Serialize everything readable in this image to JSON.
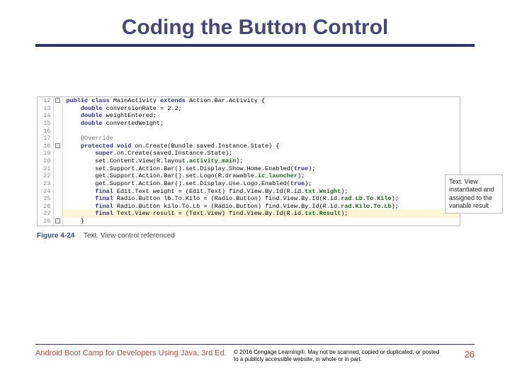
{
  "title": "Coding the Button Control",
  "callout": "Text. View instantiated and assigned to the variable result",
  "caption_fig": "Figure 4-24",
  "caption_text": "Text. View control referenced",
  "footer": {
    "book": "Android Boot Camp for Developers Using Java, 3rd Ed.",
    "copyright": "© 2016 Cengage Learning®. May not be scanned, copied or duplicated, or posted to a publicly accessible website, in whole or in part.",
    "page": "26"
  },
  "code": {
    "lines": [
      {
        "n": "12",
        "fold": "⊟",
        "hl": false,
        "html": "<span class='kw'>public class</span> MainActivity <span class='kw'>extends</span> Action.Bar.Activity {"
      },
      {
        "n": "13",
        "fold": "",
        "hl": false,
        "html": "    <span class='kw'>double</span> conversionRate = 2.2;"
      },
      {
        "n": "14",
        "fold": "",
        "hl": false,
        "html": "    <span class='kw'>double</span> weightEntered;"
      },
      {
        "n": "15",
        "fold": "",
        "hl": false,
        "html": "    <span class='kw'>double</span> convertedWeight;"
      },
      {
        "n": "16",
        "fold": "",
        "hl": false,
        "html": ""
      },
      {
        "n": "17",
        "fold": "",
        "hl": false,
        "html": "    <span class='at'>@Override</span>"
      },
      {
        "n": "18",
        "fold": "⊟",
        "hl": false,
        "html": "    <span class='kw'>protected void</span> on.Create(Bundle saved.Instance.State) {"
      },
      {
        "n": "19",
        "fold": "",
        "hl": false,
        "html": "        <span class='kw'>super</span>.on.Create(saved.Instance.State);"
      },
      {
        "n": "20",
        "fold": "",
        "hl": false,
        "html": "        set.Content.View(R.layout.<span class='st'>activity_main</span>);"
      },
      {
        "n": "21",
        "fold": "",
        "hl": false,
        "html": "        set.Support.Action.Bar().set.Display.Show.Home.Enabled(<span class='kw'>true</span>);"
      },
      {
        "n": "22",
        "fold": "",
        "hl": false,
        "html": "        get.Support.Action.Bar().set.Logo(R.drawable.<span class='st'>ic_launcher</span>);"
      },
      {
        "n": "23",
        "fold": "",
        "hl": false,
        "html": "        get.Support.Action.Bar().set.Display.Use.Logo.Enabled(<span class='kw'>true</span>);"
      },
      {
        "n": "24",
        "fold": "",
        "hl": false,
        "html": "        <span class='kw'>final</span> Edit.Text weight = (Edit.Text) find.View.By.Id(R.id.<span class='st'>txt.Weight</span>);"
      },
      {
        "n": "25",
        "fold": "",
        "hl": false,
        "html": "        <span class='kw'>final</span> Radio.Button lb.To.Kilo = (Radio.Button) find.View.By.Id(R.id.<span class='st'>rad.Lb.To.Kilo</span>);"
      },
      {
        "n": "26",
        "fold": "",
        "hl": false,
        "html": "        <span class='kw'>final</span> Radio.Button kilo.To.Lb = (Radio.Button) find.View.By.Id(R.id.<span class='st'>rad.Kilo.To.Lb</span>);"
      },
      {
        "n": "27",
        "fold": "",
        "hl": true,
        "html": "        <span class='kw'>final</span> Text.View result = (Text.View) find.View.By.Id(R.id.<span class='st'>txt.Result</span>);"
      },
      {
        "n": "28",
        "fold": "⊖",
        "hl": false,
        "html": "    }"
      }
    ]
  }
}
